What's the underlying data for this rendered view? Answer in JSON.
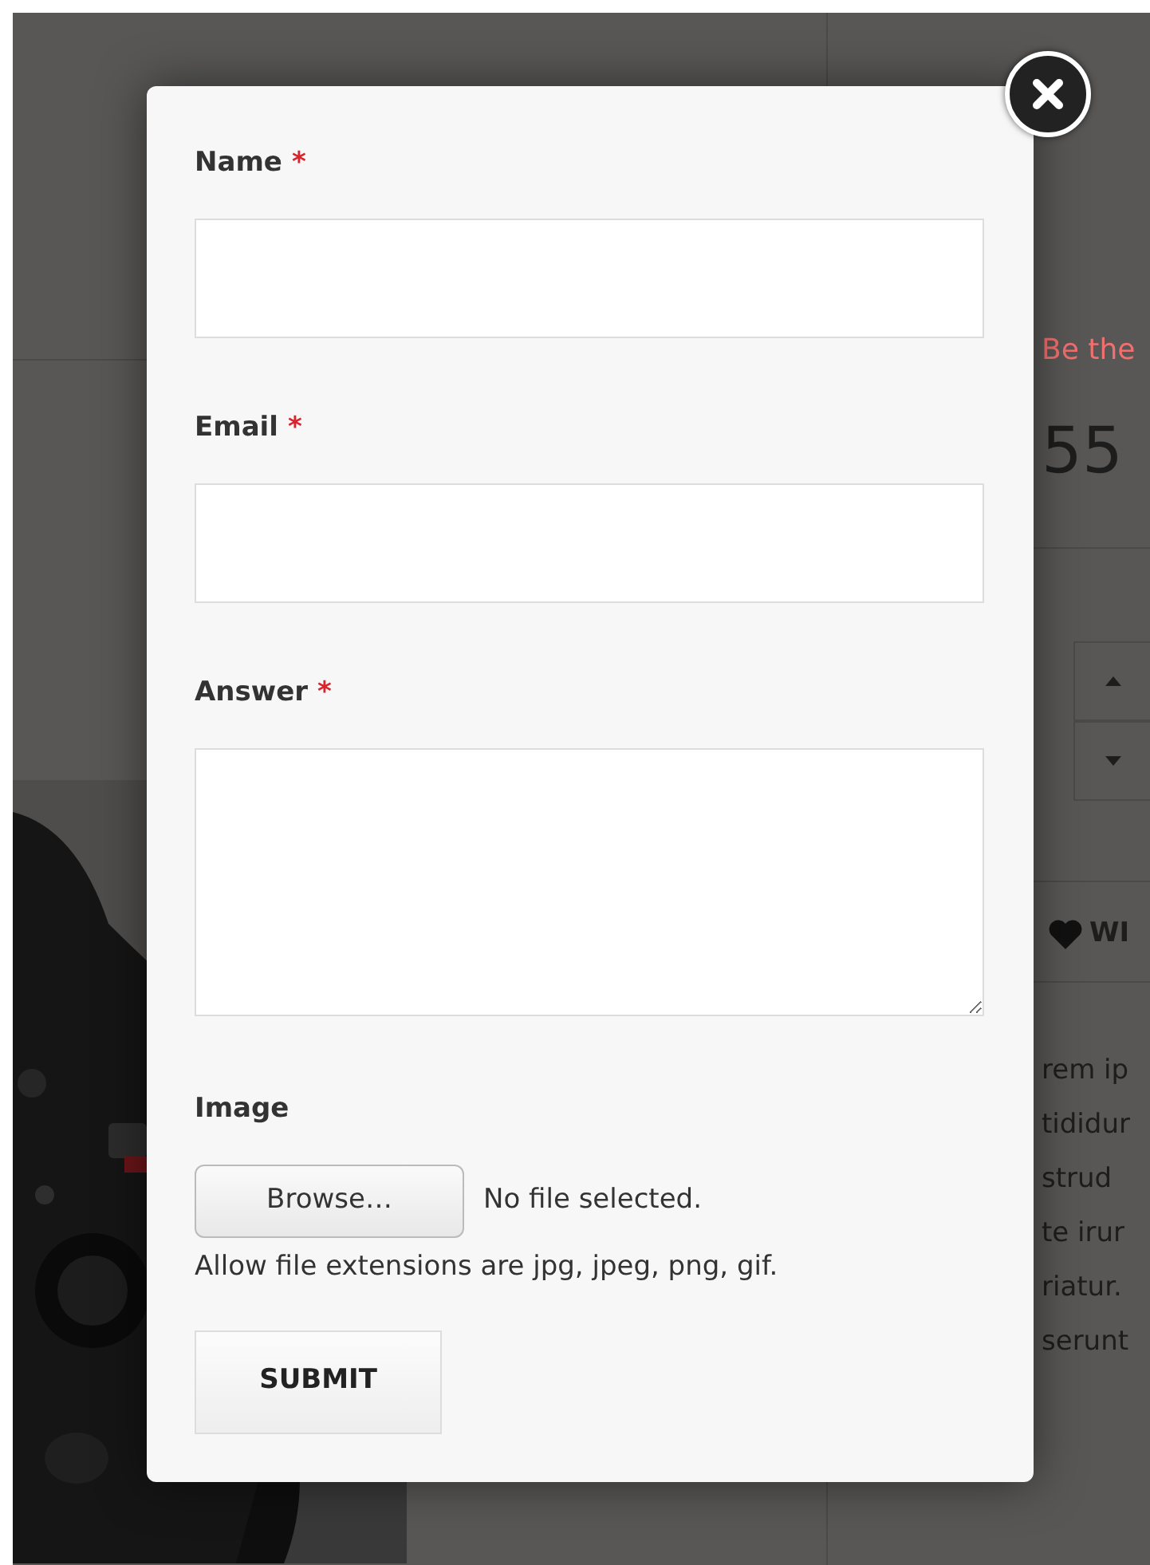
{
  "background": {
    "rating_link": "Be the",
    "price": "55",
    "wishlist": "WI",
    "description_lines": [
      "rem ip",
      "tididur",
      "strud",
      "te irur",
      "riatur.",
      "serunt"
    ]
  },
  "modal": {
    "required_mark": "*",
    "fields": [
      {
        "kind": "text",
        "label": "Name",
        "required": true
      },
      {
        "kind": "text",
        "label": "Email",
        "required": true
      },
      {
        "kind": "textarea",
        "label": "Answer",
        "required": true
      },
      {
        "kind": "file",
        "label": "Image",
        "required": false,
        "button": "Browse…",
        "status": "No file selected.",
        "help": "Allow file extensions are jpg, jpeg, png, gif."
      }
    ],
    "submit": "SUBMIT"
  }
}
